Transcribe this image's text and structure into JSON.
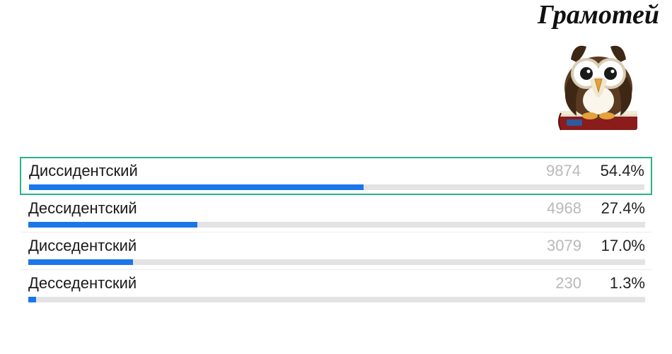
{
  "brand": {
    "title": "Грамотей"
  },
  "colors": {
    "barFill": "#1a77ea",
    "barTrack": "#e3e3e3",
    "highlightBorder": "#2bb28a",
    "countColor": "#b9b9b9"
  },
  "chart_data": {
    "type": "bar",
    "title": "",
    "xlabel": "",
    "ylabel": "",
    "xlim": [
      0,
      100
    ],
    "categories": [
      "Диссидентский",
      "Дессидентский",
      "Дисседентский",
      "Десседентский"
    ],
    "series": [
      {
        "name": "count",
        "values": [
          9874,
          4968,
          3079,
          230
        ]
      },
      {
        "name": "percent",
        "values": [
          54.4,
          27.4,
          17.0,
          1.3
        ]
      }
    ],
    "highlight_index": 0
  },
  "options": [
    {
      "label": "Диссидентский",
      "count": "9874",
      "percent": "54.4%",
      "bar_pct": 54.4,
      "highlight": true
    },
    {
      "label": "Дессидентский",
      "count": "4968",
      "percent": "27.4%",
      "bar_pct": 27.4,
      "highlight": false
    },
    {
      "label": "Дисседентский",
      "count": "3079",
      "percent": "17.0%",
      "bar_pct": 17.0,
      "highlight": false
    },
    {
      "label": "Десседентский",
      "count": "230",
      "percent": "1.3%",
      "bar_pct": 1.3,
      "highlight": false
    }
  ]
}
